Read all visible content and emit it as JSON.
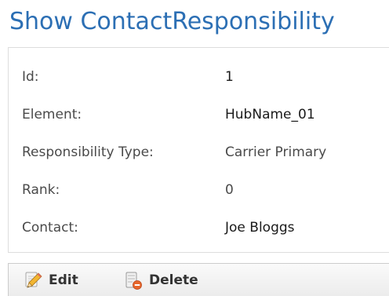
{
  "page": {
    "title": "Show ContactResponsibility"
  },
  "details": {
    "rows": [
      {
        "label": "Id:",
        "value": "1"
      },
      {
        "label": "Element:",
        "value": "HubName_01"
      },
      {
        "label": "Responsibility Type:",
        "value": "Carrier Primary"
      },
      {
        "label": "Rank:",
        "value": "0"
      },
      {
        "label": "Contact:",
        "value": "Joe Bloggs"
      }
    ]
  },
  "toolbar": {
    "edit_label": "Edit",
    "delete_label": "Delete",
    "edit_icon": "pencil-icon",
    "delete_icon": "delete-icon"
  },
  "colors": {
    "title": "#2c6fb4",
    "panel_border": "#dddddd",
    "label_text": "#4a4a4a",
    "value_text": "#1a1a1a"
  }
}
